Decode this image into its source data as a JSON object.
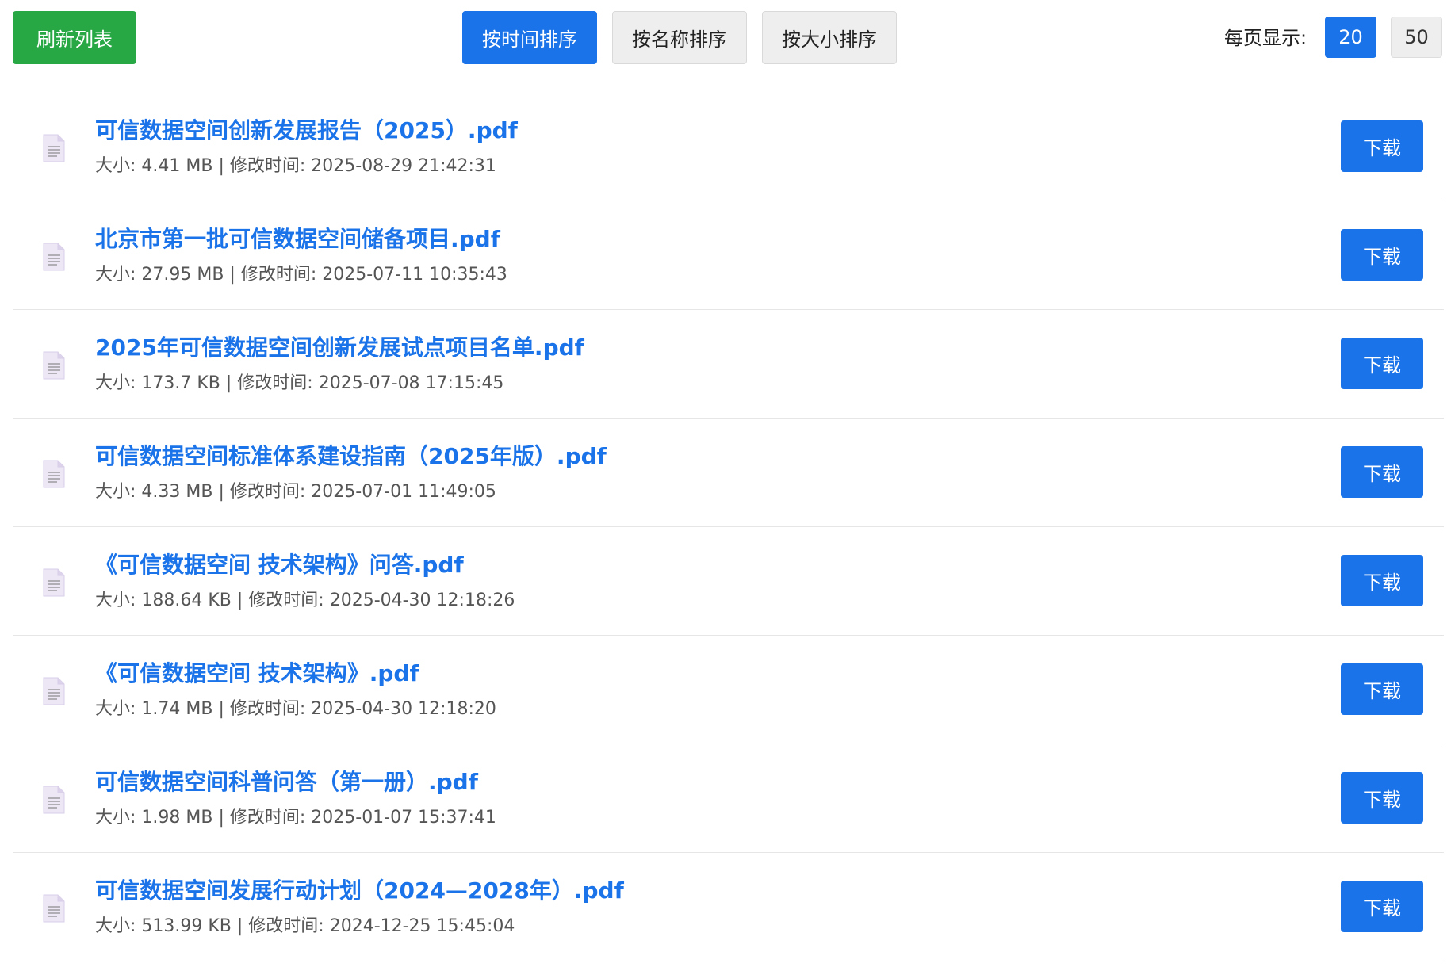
{
  "toolbar": {
    "refresh_label": "刷新列表",
    "sort_buttons": [
      {
        "label": "按时间排序",
        "active": true
      },
      {
        "label": "按名称排序",
        "active": false
      },
      {
        "label": "按大小排序",
        "active": false
      }
    ],
    "per_page_label": "每页显示:",
    "per_page_options": [
      {
        "label": "20",
        "active": true
      },
      {
        "label": "50",
        "active": false
      }
    ]
  },
  "files": [
    {
      "name": "可信数据空间创新发展报告（2025）.pdf",
      "meta": "大小: 4.41 MB | 修改时间: 2025-08-29 21:42:31",
      "download_label": "下载",
      "icon": "document-icon"
    },
    {
      "name": "北京市第一批可信数据空间储备项目.pdf",
      "meta": "大小: 27.95 MB | 修改时间: 2025-07-11 10:35:43",
      "download_label": "下载",
      "icon": "document-icon"
    },
    {
      "name": "2025年可信数据空间创新发展试点项目名单.pdf",
      "meta": "大小: 173.7 KB | 修改时间: 2025-07-08 17:15:45",
      "download_label": "下载",
      "icon": "document-icon"
    },
    {
      "name": "可信数据空间标准体系建设指南（2025年版）.pdf",
      "meta": "大小: 4.33 MB | 修改时间: 2025-07-01 11:49:05",
      "download_label": "下载",
      "icon": "document-icon"
    },
    {
      "name": "《可信数据空间 技术架构》问答.pdf",
      "meta": "大小: 188.64 KB | 修改时间: 2025-04-30 12:18:26",
      "download_label": "下载",
      "icon": "document-icon"
    },
    {
      "name": "《可信数据空间 技术架构》.pdf",
      "meta": "大小: 1.74 MB | 修改时间: 2025-04-30 12:18:20",
      "download_label": "下载",
      "icon": "document-icon"
    },
    {
      "name": "可信数据空间科普问答（第一册）.pdf",
      "meta": "大小: 1.98 MB | 修改时间: 2025-01-07 15:37:41",
      "download_label": "下载",
      "icon": "document-icon"
    },
    {
      "name": "可信数据空间发展行动计划（2024—2028年）.pdf",
      "meta": "大小: 513.99 KB | 修改时间: 2024-12-25 15:45:04",
      "download_label": "下载",
      "icon": "document-icon"
    }
  ]
}
